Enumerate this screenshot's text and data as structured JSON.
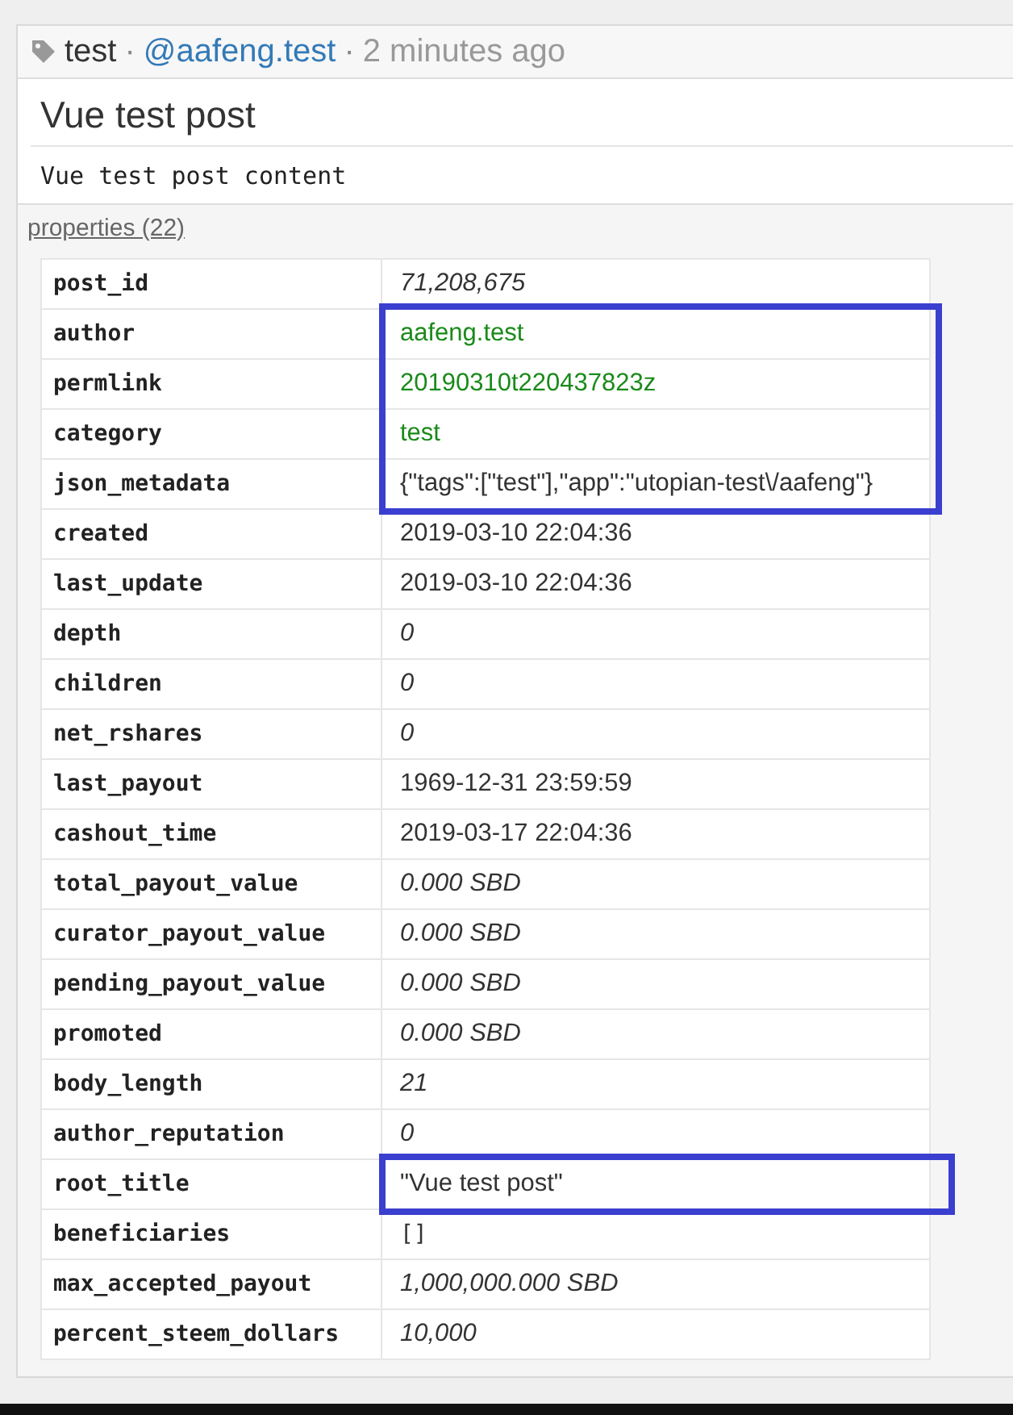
{
  "header": {
    "tag": "test",
    "separator": "·",
    "author": "@aafeng.test",
    "time": "2 minutes ago"
  },
  "title": "Vue test post",
  "body": "Vue test post content",
  "properties_link": "properties (22)",
  "rows": [
    {
      "key": "post_id",
      "value": "71,208,675",
      "kind": "number",
      "highlighted": false
    },
    {
      "key": "author",
      "value": "aafeng.test",
      "kind": "account",
      "highlighted": true
    },
    {
      "key": "permlink",
      "value": "20190310t220437823z",
      "kind": "account",
      "highlighted": true
    },
    {
      "key": "category",
      "value": "test",
      "kind": "account",
      "highlighted": true
    },
    {
      "key": "json_metadata",
      "value": "{\"tags\":[\"test\"],\"app\":\"utopian-test\\/aafeng\"}",
      "kind": "text",
      "highlighted": true
    },
    {
      "key": "created",
      "value": "2019-03-10 22:04:36",
      "kind": "text",
      "highlighted": false
    },
    {
      "key": "last_update",
      "value": "2019-03-10 22:04:36",
      "kind": "text",
      "highlighted": false
    },
    {
      "key": "depth",
      "value": "0",
      "kind": "number",
      "highlighted": false
    },
    {
      "key": "children",
      "value": "0",
      "kind": "number",
      "highlighted": false
    },
    {
      "key": "net_rshares",
      "value": "0",
      "kind": "number",
      "highlighted": false
    },
    {
      "key": "last_payout",
      "value": "1969-12-31 23:59:59",
      "kind": "text",
      "highlighted": false
    },
    {
      "key": "cashout_time",
      "value": "2019-03-17 22:04:36",
      "kind": "text",
      "highlighted": false
    },
    {
      "key": "total_payout_value",
      "value": "0.000 SBD",
      "kind": "number",
      "highlighted": false
    },
    {
      "key": "curator_payout_value",
      "value": "0.000 SBD",
      "kind": "number",
      "highlighted": false
    },
    {
      "key": "pending_payout_value",
      "value": "0.000 SBD",
      "kind": "number",
      "highlighted": false
    },
    {
      "key": "promoted",
      "value": "0.000 SBD",
      "kind": "number",
      "highlighted": false
    },
    {
      "key": "body_length",
      "value": "21",
      "kind": "number",
      "highlighted": false
    },
    {
      "key": "author_reputation",
      "value": "0",
      "kind": "number",
      "highlighted": false
    },
    {
      "key": "root_title",
      "value": "\"Vue test post\"",
      "kind": "text",
      "highlighted": true
    },
    {
      "key": "beneficiaries",
      "value": "[]",
      "kind": "code",
      "highlighted": false
    },
    {
      "key": "max_accepted_payout",
      "value": "1,000,000.000 SBD",
      "kind": "number",
      "highlighted": false
    },
    {
      "key": "percent_steem_dollars",
      "value": "10,000",
      "kind": "number",
      "highlighted": false
    }
  ]
}
